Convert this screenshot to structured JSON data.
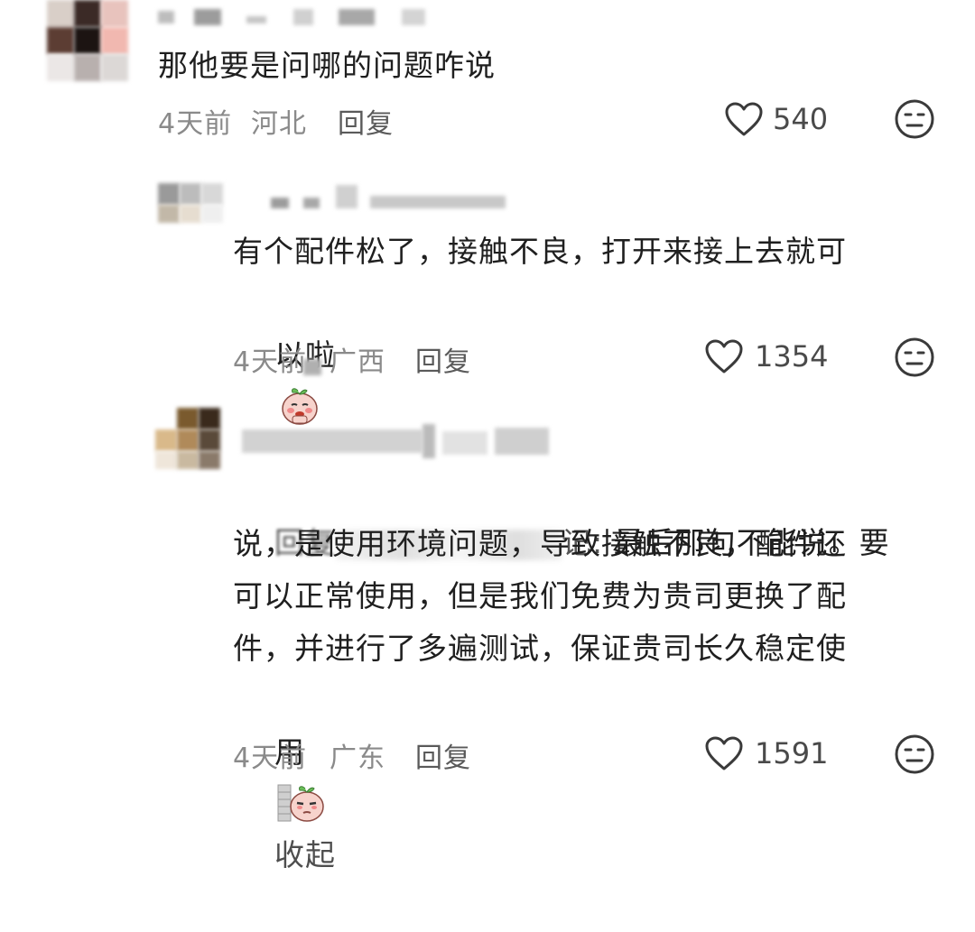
{
  "comments": [
    {
      "text": "那他要是问哪的问题咋说",
      "time": "4天前",
      "location": "河北",
      "reply_label": "回复",
      "likes": "540"
    },
    {
      "text_line1": "有个配件松了，接触不良，打开来接上去就可",
      "text_line2": "以啦",
      "time": "4天前",
      "location": "广西",
      "reply_label": "回复",
      "likes": "1354"
    },
    {
      "reply_prefix": "回复",
      "reply_target_suffix": "记: ",
      "text_line1": "最后那句不能说。要",
      "text_line2": "说，是使用环境问题，导致接触不良，配件还",
      "text_line3": "可以正常使用，但是我们免费为贵司更换了配",
      "text_line4": "件，并进行了多遍测试，保证贵司长久稳定使",
      "text_line5": "用",
      "collapse_label": "收起",
      "time": "4天前",
      "location": "广东",
      "reply_label": "回复",
      "likes": "1591"
    }
  ],
  "icons": {
    "like": "heart-outline-icon",
    "dislike": "neutral-face-icon",
    "sticker": "peach-sticker"
  },
  "colors": {
    "text": "#1f1f1f",
    "meta": "#8a8a8a",
    "icon": "#3a3a3a"
  }
}
